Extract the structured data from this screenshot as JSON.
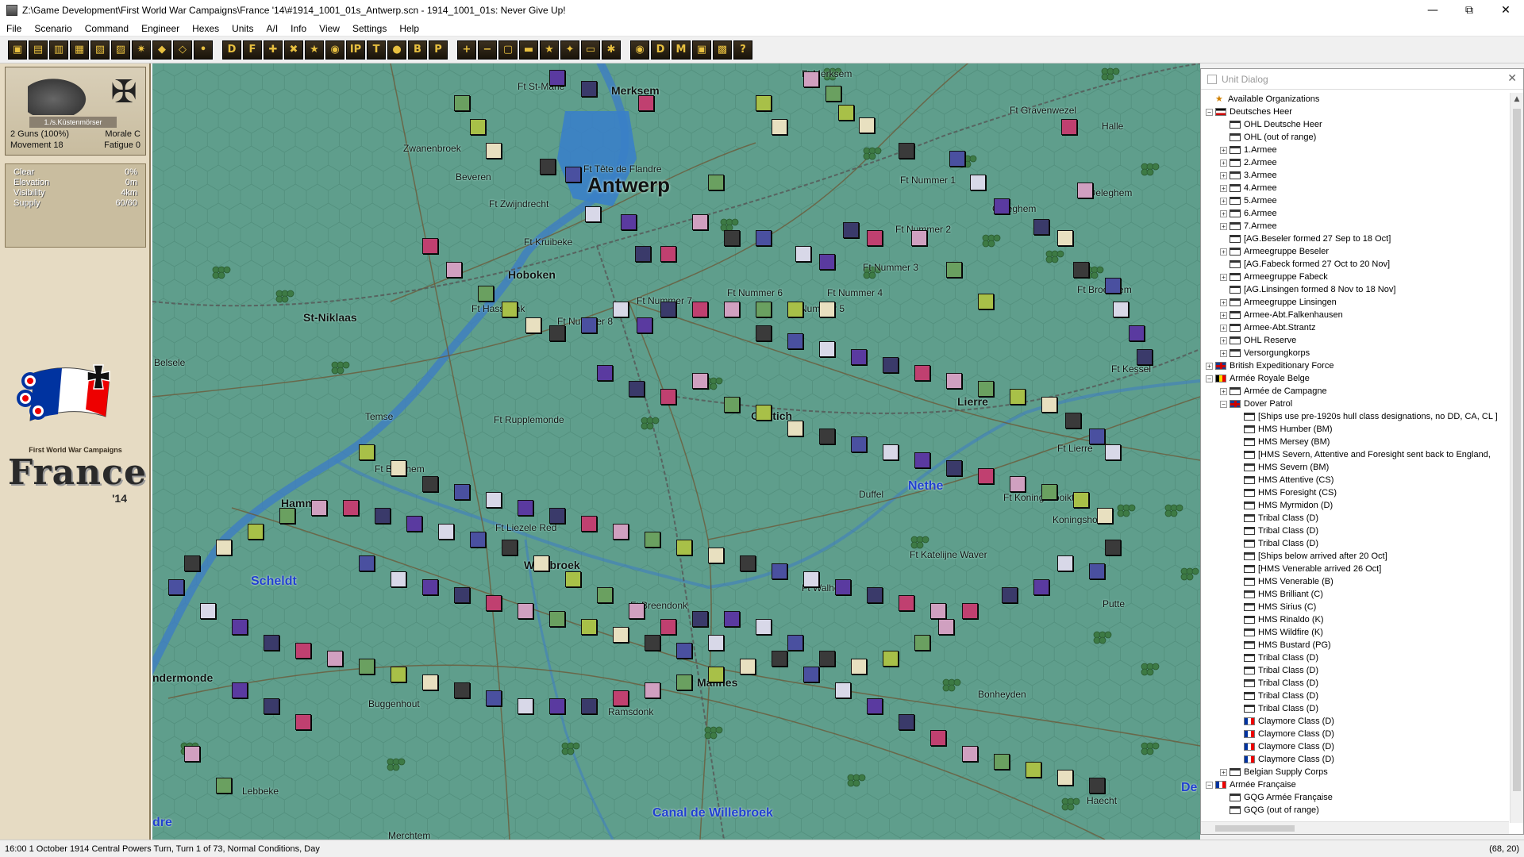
{
  "window": {
    "title": "Z:\\Game Development\\First World War Campaigns\\France '14\\#1914_1001_01s_Antwerp.scn - 1914_1001_01s: Never Give Up!",
    "minimize": "—",
    "restore": "⧉",
    "close": "✕"
  },
  "menu": [
    "File",
    "Scenario",
    "Command",
    "Engineer",
    "Hexes",
    "Units",
    "A/I",
    "Info",
    "View",
    "Settings",
    "Help"
  ],
  "toolbar": {
    "buttons": [
      "▣",
      "▤",
      "▥",
      "▦",
      "▧",
      "▨",
      "✷",
      "◆",
      "◇",
      "•",
      "D",
      "F",
      "✚",
      "✖",
      "★",
      "◉",
      "IP",
      "T",
      "●",
      "B",
      "P",
      "+",
      "−",
      "▢",
      "▬",
      "★",
      "✦",
      "▭",
      "✱",
      "◉",
      "D",
      "M",
      "▣",
      "▩",
      "?"
    ]
  },
  "unit_card": {
    "name": "1./s.Küstenmörser",
    "guns": "2 Guns (100%)",
    "morale": "Morale C",
    "movement": "Movement 18",
    "fatigue": "Fatigue 0",
    "cross": "✠"
  },
  "terrain": [
    {
      "label": "Clear",
      "value": "0%"
    },
    {
      "label": "Elevation",
      "value": "0m"
    },
    {
      "label": "Visibility",
      "value": "4km"
    },
    {
      "label": "Supply",
      "value": "60/60"
    }
  ],
  "logo": {
    "subtitle": "First World War Campaigns",
    "title": "France",
    "year": "'14"
  },
  "map": {
    "places": [
      {
        "name": "Antwerp",
        "style": "big"
      },
      {
        "name": "Merksem",
        "style": "bold"
      },
      {
        "name": "Hoboken",
        "style": "bold"
      },
      {
        "name": "St-Niklaas",
        "style": "bold"
      },
      {
        "name": "Hamme",
        "style": "bold"
      },
      {
        "name": "Willebroek",
        "style": "bold"
      },
      {
        "name": "Malines",
        "style": "bold"
      },
      {
        "name": "Lierre",
        "style": "bold"
      },
      {
        "name": "Contich",
        "style": "bold"
      },
      {
        "name": "Zwanenbroek",
        "style": ""
      },
      {
        "name": "Beveren",
        "style": ""
      },
      {
        "name": "Ft St-Marie",
        "style": ""
      },
      {
        "name": "Ft Merksem",
        "style": ""
      },
      {
        "name": "Ft Gravenwezel",
        "style": ""
      },
      {
        "name": "Halle",
        "style": ""
      },
      {
        "name": "Ft Tête de Flandre",
        "style": ""
      },
      {
        "name": "Ft Zwijndrecht",
        "style": ""
      },
      {
        "name": "Ft Kruibeke",
        "style": ""
      },
      {
        "name": "Ft Nummer 1",
        "style": ""
      },
      {
        "name": "Ft Nummer 2",
        "style": ""
      },
      {
        "name": "Ft Nummer 3",
        "style": ""
      },
      {
        "name": "Ft Nummer 4",
        "style": ""
      },
      {
        "name": "Ft Nummer 5",
        "style": ""
      },
      {
        "name": "Ft Nummer 6",
        "style": ""
      },
      {
        "name": "Ft Nummer 7",
        "style": ""
      },
      {
        "name": "Ft Nummer 8",
        "style": ""
      },
      {
        "name": "Ft Oeleghem",
        "style": ""
      },
      {
        "name": "Oeleghem",
        "style": ""
      },
      {
        "name": "Ft Broechem",
        "style": ""
      },
      {
        "name": "Ft Hassdonk",
        "style": ""
      },
      {
        "name": "Ft Kessel",
        "style": ""
      },
      {
        "name": "Belsele",
        "style": ""
      },
      {
        "name": "Temse",
        "style": ""
      },
      {
        "name": "Ft Rupplemonde",
        "style": ""
      },
      {
        "name": "Ft Lierre",
        "style": ""
      },
      {
        "name": "Ft Bornhem",
        "style": ""
      },
      {
        "name": "Ft Liezele Red",
        "style": ""
      },
      {
        "name": "Duffel",
        "style": ""
      },
      {
        "name": "Ft Koningshooikt",
        "style": ""
      },
      {
        "name": "Koningshooikt",
        "style": ""
      },
      {
        "name": "Ft Katelijne Waver",
        "style": ""
      },
      {
        "name": "Ft Walhem",
        "style": ""
      },
      {
        "name": "Ft Breendonk",
        "style": ""
      },
      {
        "name": "Putte",
        "style": ""
      },
      {
        "name": "Buggenhout",
        "style": ""
      },
      {
        "name": "Ramsdonk",
        "style": ""
      },
      {
        "name": "Bonheyden",
        "style": ""
      },
      {
        "name": "Lebbeke",
        "style": ""
      },
      {
        "name": "Merchtem",
        "style": ""
      },
      {
        "name": "Haecht",
        "style": ""
      },
      {
        "name": "ndermonde",
        "style": "bold"
      },
      {
        "name": "Scheldt",
        "style": "water"
      },
      {
        "name": "Nethe",
        "style": "water"
      },
      {
        "name": "Canal de Willebroek",
        "style": "water"
      },
      {
        "name": "dre",
        "style": "water"
      },
      {
        "name": "De",
        "style": "water"
      }
    ]
  },
  "unit_dialog": {
    "title": "Unit Dialog",
    "close": "✕",
    "tree": [
      {
        "level": 0,
        "exp": "",
        "icon": "star",
        "label": "Available Organizations"
      },
      {
        "level": 0,
        "exp": "−",
        "icon": "flag-de",
        "label": "Deutsches Heer"
      },
      {
        "level": 1,
        "exp": "",
        "icon": "folder",
        "label": "OHL Deutsche Heer"
      },
      {
        "level": 1,
        "exp": "",
        "icon": "folder",
        "label": "OHL (out of range)"
      },
      {
        "level": 1,
        "exp": "+",
        "icon": "folder",
        "label": "1.Armee"
      },
      {
        "level": 1,
        "exp": "+",
        "icon": "folder",
        "label": "2.Armee"
      },
      {
        "level": 1,
        "exp": "+",
        "icon": "folder",
        "label": "3.Armee"
      },
      {
        "level": 1,
        "exp": "+",
        "icon": "folder",
        "label": "4.Armee"
      },
      {
        "level": 1,
        "exp": "+",
        "icon": "folder",
        "label": "5.Armee"
      },
      {
        "level": 1,
        "exp": "+",
        "icon": "folder",
        "label": "6.Armee"
      },
      {
        "level": 1,
        "exp": "+",
        "icon": "folder",
        "label": "7.Armee"
      },
      {
        "level": 1,
        "exp": "",
        "icon": "folder",
        "label": "[AG.Beseler formed 27 Sep to 18 Oct]"
      },
      {
        "level": 1,
        "exp": "+",
        "icon": "folder",
        "label": "Armeegruppe Beseler"
      },
      {
        "level": 1,
        "exp": "",
        "icon": "folder",
        "label": "[AG.Fabeck formed 27 Oct to 20 Nov]"
      },
      {
        "level": 1,
        "exp": "+",
        "icon": "folder",
        "label": "Armeegruppe Fabeck"
      },
      {
        "level": 1,
        "exp": "",
        "icon": "folder",
        "label": "[AG.Linsingen formed 8 Nov to 18 Nov]"
      },
      {
        "level": 1,
        "exp": "+",
        "icon": "folder",
        "label": "Armeegruppe Linsingen"
      },
      {
        "level": 1,
        "exp": "+",
        "icon": "folder",
        "label": "Armee-Abt.Falkenhausen"
      },
      {
        "level": 1,
        "exp": "+",
        "icon": "folder",
        "label": "Armee-Abt.Strantz"
      },
      {
        "level": 1,
        "exp": "+",
        "icon": "folder",
        "label": "OHL Reserve"
      },
      {
        "level": 1,
        "exp": "+",
        "icon": "folder",
        "label": "Versorgungkorps"
      },
      {
        "level": 0,
        "exp": "+",
        "icon": "flag-uk",
        "label": "British Expeditionary Force"
      },
      {
        "level": 0,
        "exp": "−",
        "icon": "flag-be",
        "label": "Armée Royale Belge"
      },
      {
        "level": 1,
        "exp": "+",
        "icon": "folder",
        "label": "Armée de Campagne"
      },
      {
        "level": 1,
        "exp": "−",
        "icon": "flag-uk",
        "label": "Dover Patrol"
      },
      {
        "level": 2,
        "exp": "",
        "icon": "folder",
        "label": "[Ships use pre-1920s hull class designations, no DD, CA, CL ]"
      },
      {
        "level": 2,
        "exp": "",
        "icon": "folder",
        "label": "HMS Humber (BM)"
      },
      {
        "level": 2,
        "exp": "",
        "icon": "folder",
        "label": "HMS Mersey (BM)"
      },
      {
        "level": 2,
        "exp": "",
        "icon": "folder",
        "label": "[HMS Severn, Attentive and Foresight sent back to England,"
      },
      {
        "level": 2,
        "exp": "",
        "icon": "folder",
        "label": "HMS Severn (BM)"
      },
      {
        "level": 2,
        "exp": "",
        "icon": "folder",
        "label": "HMS Attentive (CS)"
      },
      {
        "level": 2,
        "exp": "",
        "icon": "folder",
        "label": "HMS Foresight (CS)"
      },
      {
        "level": 2,
        "exp": "",
        "icon": "folder",
        "label": "HMS Myrmidon (D)"
      },
      {
        "level": 2,
        "exp": "",
        "icon": "folder",
        "label": "Tribal Class (D)"
      },
      {
        "level": 2,
        "exp": "",
        "icon": "folder",
        "label": "Tribal Class (D)"
      },
      {
        "level": 2,
        "exp": "",
        "icon": "folder",
        "label": "Tribal Class (D)"
      },
      {
        "level": 2,
        "exp": "",
        "icon": "folder",
        "label": "[Ships below arrived after 20 Oct]"
      },
      {
        "level": 2,
        "exp": "",
        "icon": "folder",
        "label": "[HMS Venerable arrived 26 Oct]"
      },
      {
        "level": 2,
        "exp": "",
        "icon": "folder",
        "label": "HMS Venerable (B)"
      },
      {
        "level": 2,
        "exp": "",
        "icon": "folder",
        "label": "HMS Brilliant (C)"
      },
      {
        "level": 2,
        "exp": "",
        "icon": "folder",
        "label": "HMS Sirius (C)"
      },
      {
        "level": 2,
        "exp": "",
        "icon": "folder",
        "label": "HMS Rinaldo (K)"
      },
      {
        "level": 2,
        "exp": "",
        "icon": "folder",
        "label": "HMS Wildfire (K)"
      },
      {
        "level": 2,
        "exp": "",
        "icon": "folder",
        "label": "HMS Bustard (PG)"
      },
      {
        "level": 2,
        "exp": "",
        "icon": "folder",
        "label": "Tribal Class (D)"
      },
      {
        "level": 2,
        "exp": "",
        "icon": "folder",
        "label": "Tribal Class (D)"
      },
      {
        "level": 2,
        "exp": "",
        "icon": "folder",
        "label": "Tribal Class (D)"
      },
      {
        "level": 2,
        "exp": "",
        "icon": "folder",
        "label": "Tribal Class (D)"
      },
      {
        "level": 2,
        "exp": "",
        "icon": "folder",
        "label": "Tribal Class (D)"
      },
      {
        "level": 2,
        "exp": "",
        "icon": "flag-fr",
        "label": "Claymore Class (D)"
      },
      {
        "level": 2,
        "exp": "",
        "icon": "flag-fr",
        "label": "Claymore Class (D)"
      },
      {
        "level": 2,
        "exp": "",
        "icon": "flag-fr",
        "label": "Claymore Class (D)"
      },
      {
        "level": 2,
        "exp": "",
        "icon": "flag-fr",
        "label": "Claymore Class (D)"
      },
      {
        "level": 1,
        "exp": "+",
        "icon": "folder",
        "label": "Belgian Supply Corps"
      },
      {
        "level": 0,
        "exp": "−",
        "icon": "flag-fr",
        "label": "Armée Française"
      },
      {
        "level": 1,
        "exp": "",
        "icon": "folder",
        "label": "GQG Armée Française"
      },
      {
        "level": 1,
        "exp": "",
        "icon": "folder",
        "label": "GQG (out of range)"
      }
    ]
  },
  "status": {
    "left": "16:00 1 October 1914 Central Powers Turn, Turn 1 of 73, Normal Conditions, Day",
    "right": "(68, 20)"
  }
}
